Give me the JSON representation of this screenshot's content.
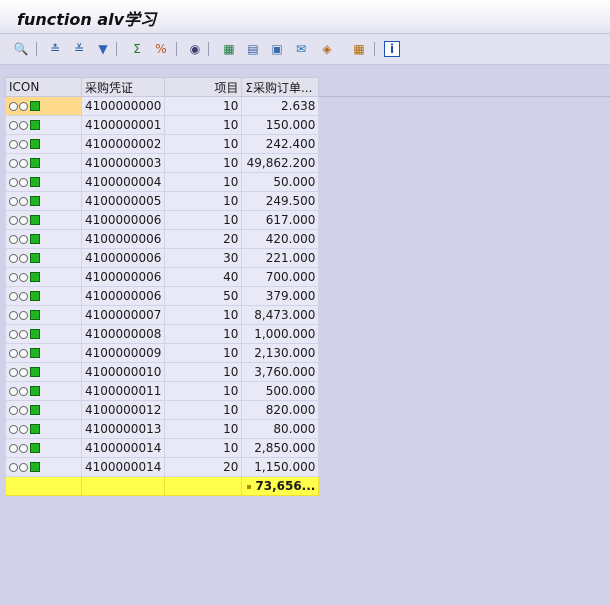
{
  "window": {
    "title": "function alv学习"
  },
  "toolbar": {
    "buttons": [
      {
        "name": "details-icon",
        "glyph": "🔍",
        "color": "#2e6e2e"
      },
      {
        "name": "sort-ascending-icon",
        "glyph": "≛",
        "color": "#1e5a9e"
      },
      {
        "name": "sort-descending-icon",
        "glyph": "≚",
        "color": "#1e5a9e"
      },
      {
        "name": "filter-icon",
        "glyph": "▼",
        "color": "#2a63b8"
      },
      {
        "name": "total-icon",
        "glyph": "Σ",
        "color": "#1d7d1d"
      },
      {
        "name": "subtotal-icon",
        "glyph": "%",
        "color": "#c0521c"
      },
      {
        "name": "print-preview-icon",
        "glyph": "◉",
        "color": "#3b3b6e"
      },
      {
        "name": "export-excel-icon",
        "glyph": "▦",
        "color": "#1c7a3c"
      },
      {
        "name": "word-processing-icon",
        "glyph": "▤",
        "color": "#3a5e9e"
      },
      {
        "name": "local-file-icon",
        "glyph": "▣",
        "color": "#3b6aa8"
      },
      {
        "name": "send-mail-icon",
        "glyph": "✉",
        "color": "#1e6fb8"
      },
      {
        "name": "abc-analysis-icon",
        "glyph": "◈",
        "color": "#b86a1c"
      },
      {
        "name": "graphic-icon",
        "glyph": "◐",
        "color": "#8a5a1c"
      },
      {
        "name": "change-layout-icon",
        "glyph": "▦",
        "color": "#b06a00"
      },
      {
        "name": "information-icon",
        "glyph": "i",
        "color": "#1e4fb8"
      }
    ]
  },
  "grid": {
    "columns": [
      {
        "label": "ICON"
      },
      {
        "label": "采购凭证"
      },
      {
        "label": "项目"
      },
      {
        "label": "Σ采购订单..."
      }
    ],
    "rows": [
      {
        "doc": "4100000000",
        "item": "10",
        "value": "2.638"
      },
      {
        "doc": "4100000001",
        "item": "10",
        "value": "150.000"
      },
      {
        "doc": "4100000002",
        "item": "10",
        "value": "242.400"
      },
      {
        "doc": "4100000003",
        "item": "10",
        "value": "49,862.200"
      },
      {
        "doc": "4100000004",
        "item": "10",
        "value": "50.000"
      },
      {
        "doc": "4100000005",
        "item": "10",
        "value": "249.500"
      },
      {
        "doc": "4100000006",
        "item": "10",
        "value": "617.000"
      },
      {
        "doc": "4100000006",
        "item": "20",
        "value": "420.000"
      },
      {
        "doc": "4100000006",
        "item": "30",
        "value": "221.000"
      },
      {
        "doc": "4100000006",
        "item": "40",
        "value": "700.000"
      },
      {
        "doc": "4100000006",
        "item": "50",
        "value": "379.000"
      },
      {
        "doc": "4100000007",
        "item": "10",
        "value": "8,473.000"
      },
      {
        "doc": "4100000008",
        "item": "10",
        "value": "1,000.000"
      },
      {
        "doc": "4100000009",
        "item": "10",
        "value": "2,130.000"
      },
      {
        "doc": "4100000010",
        "item": "10",
        "value": "3,760.000"
      },
      {
        "doc": "4100000011",
        "item": "10",
        "value": "500.000"
      },
      {
        "doc": "4100000012",
        "item": "10",
        "value": "820.000"
      },
      {
        "doc": "4100000013",
        "item": "10",
        "value": "80.000"
      },
      {
        "doc": "4100000014",
        "item": "10",
        "value": "2,850.000"
      },
      {
        "doc": "4100000014",
        "item": "20",
        "value": "1,150.000"
      }
    ],
    "total": "73,656..."
  }
}
